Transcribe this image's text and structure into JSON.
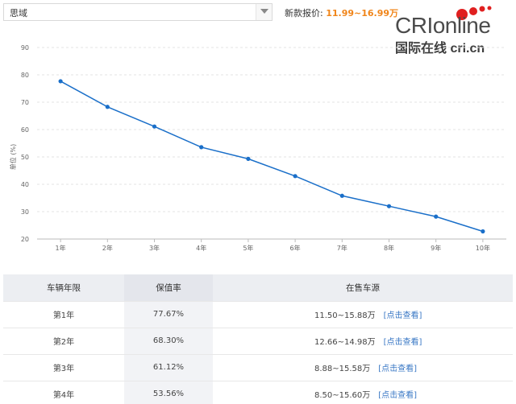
{
  "selector": {
    "value": "思域"
  },
  "price": {
    "label": "新款报价:",
    "value": "11.99~16.99万"
  },
  "logo": {
    "line1": "CRIonline",
    "line2": "国际在线 cri.cn"
  },
  "chart_data": {
    "type": "line",
    "ylabel": "单位 (%)",
    "ylim": [
      20,
      90
    ],
    "yticks": [
      20,
      30,
      40,
      50,
      60,
      70,
      80,
      90
    ],
    "categories": [
      "1年",
      "2年",
      "3年",
      "4年",
      "5年",
      "6年",
      "7年",
      "8年",
      "9年",
      "10年"
    ],
    "series": [
      {
        "values": [
          77.67,
          68.3,
          61.12,
          53.56,
          49.3,
          43.0,
          35.8,
          32.0,
          28.2,
          22.8
        ],
        "color": "#1a6fc9"
      }
    ],
    "grid": "horizontal dashed"
  },
  "table": {
    "headers": [
      "车辆年限",
      "保值率",
      "在售车源"
    ],
    "rows": [
      {
        "year": "第1年",
        "rate": "77.67%",
        "range": "11.50~15.88万",
        "link": "[点击查看]"
      },
      {
        "year": "第2年",
        "rate": "68.30%",
        "range": "12.66~14.98万",
        "link": "[点击查看]"
      },
      {
        "year": "第3年",
        "rate": "61.12%",
        "range": "8.88~15.58万",
        "link": "[点击查看]"
      },
      {
        "year": "第4年",
        "rate": "53.56%",
        "range": "8.50~15.60万",
        "link": "[点击查看]"
      }
    ]
  }
}
